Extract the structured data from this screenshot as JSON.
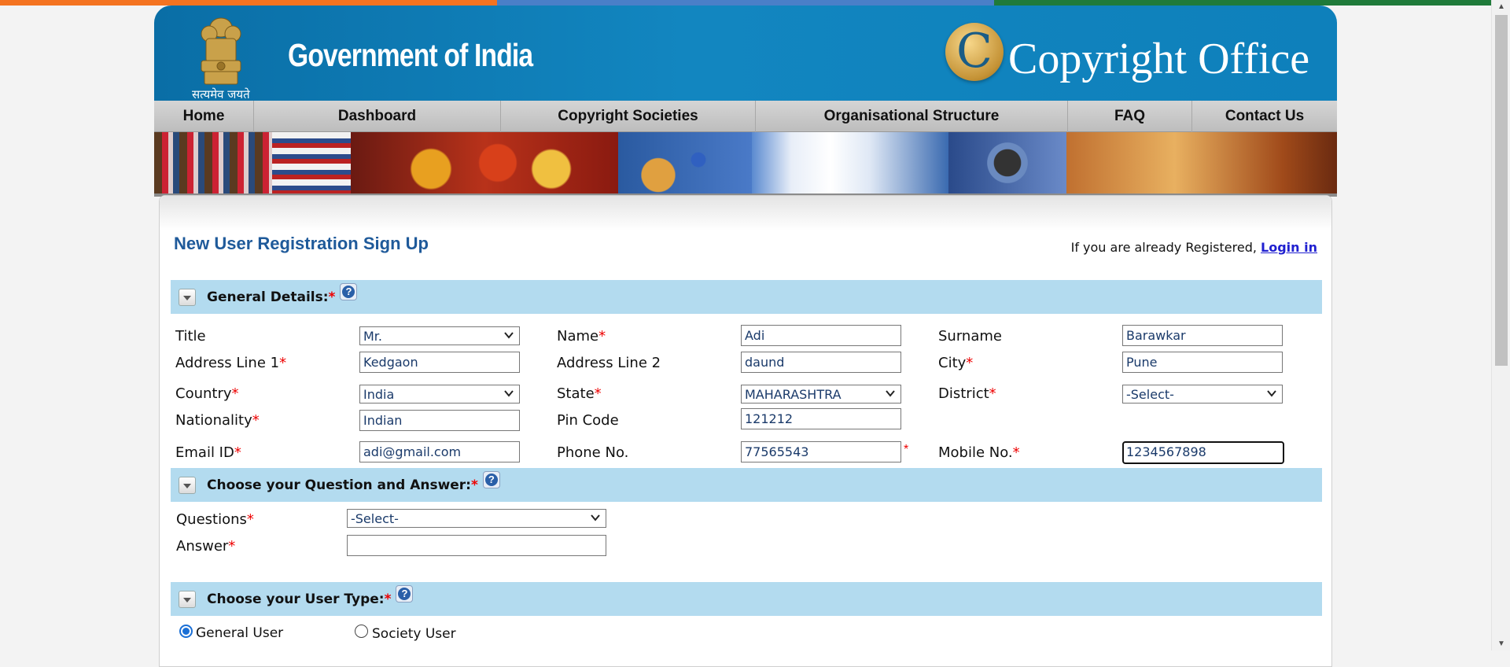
{
  "colors": {
    "saffron": "#f47320",
    "blue": "#4a7fc8",
    "green": "#1f7a3a",
    "header_blue": "#0e80bb",
    "section_bar": "#b3dbef",
    "required": "#ee0000"
  },
  "header": {
    "emblem_text": "सत्यमेव जयते",
    "gov_title": "Government of India",
    "logo_letter": "C",
    "office_title": "Copyright Office"
  },
  "nav": {
    "items": [
      {
        "label": "Home"
      },
      {
        "label": "Dashboard"
      },
      {
        "label": "Copyright Societies"
      },
      {
        "label": "Organisational Structure"
      },
      {
        "label": "FAQ"
      },
      {
        "label": "Contact Us"
      }
    ]
  },
  "page": {
    "title": "New User Registration Sign Up",
    "login_note": "If you are already Registered,",
    "login_link": "Login in"
  },
  "sections": {
    "general": {
      "title": "General Details:",
      "required_mark": "*",
      "help_icon": "?"
    },
    "question": {
      "title": "Choose your Question and Answer:",
      "required_mark": "*",
      "help_icon": "?"
    },
    "user_type": {
      "title": "Choose your User Type:",
      "required_mark": "*",
      "help_icon": "?"
    }
  },
  "general_fields": {
    "title": {
      "label": "Title",
      "value": "Mr."
    },
    "name": {
      "label": "Name",
      "req": "*",
      "value": "Adi"
    },
    "surname": {
      "label": "Surname",
      "value": "Barawkar"
    },
    "address1": {
      "label": "Address Line 1",
      "req": "*",
      "value": "Kedgaon"
    },
    "address2": {
      "label": "Address Line 2",
      "value": "daund"
    },
    "city": {
      "label": "City",
      "req": "*",
      "value": "Pune"
    },
    "country": {
      "label": "Country",
      "req": "*",
      "value": "India"
    },
    "state": {
      "label": "State",
      "req": "*",
      "value": "MAHARASHTRA"
    },
    "district": {
      "label": "District",
      "req": "*",
      "value": "-Select-"
    },
    "nationality": {
      "label": "Nationality",
      "req": "*",
      "value": "Indian"
    },
    "pincode": {
      "label": "Pin Code",
      "value": "121212"
    },
    "email": {
      "label": "Email ID",
      "req": "*",
      "value": "adi@gmail.com"
    },
    "phone": {
      "label": "Phone No.",
      "value": "77565543",
      "req_after": "*"
    },
    "mobile": {
      "label": "Mobile No.",
      "req": "*",
      "value": "1234567898"
    }
  },
  "question_fields": {
    "questions": {
      "label": "Questions",
      "req": "*",
      "value": "-Select-"
    },
    "answer": {
      "label": "Answer",
      "req": "*",
      "value": ""
    }
  },
  "user_type": {
    "options": [
      {
        "label": "General User",
        "selected": true
      },
      {
        "label": "Society User",
        "selected": false
      }
    ]
  }
}
